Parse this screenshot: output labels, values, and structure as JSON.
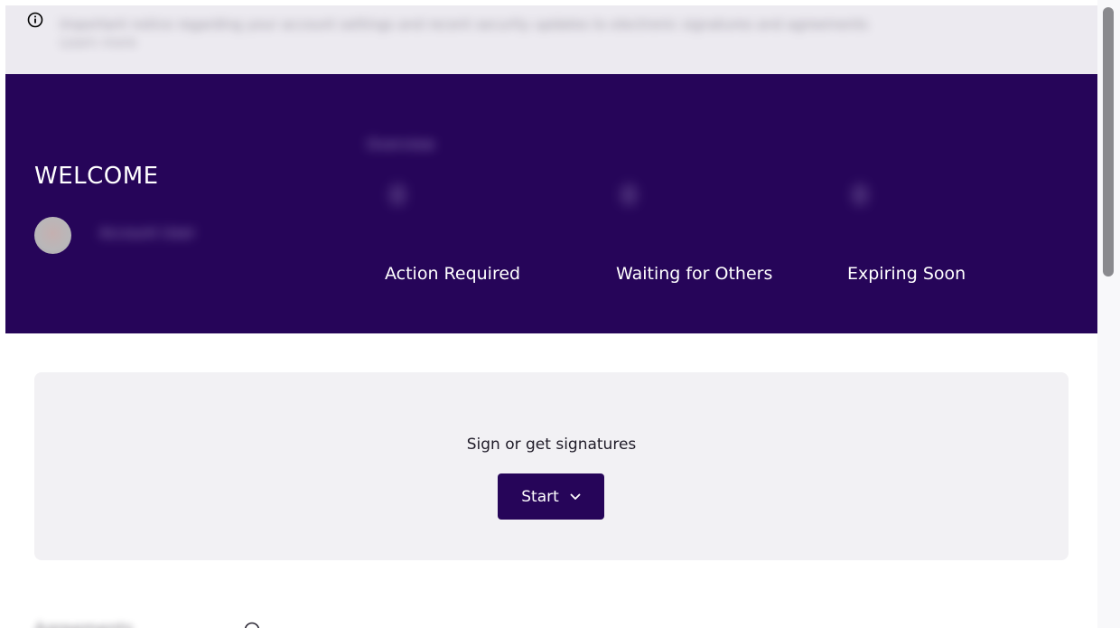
{
  "banner": {
    "icon": "info-icon",
    "text": "Important notice regarding your account settings and recent security updates to electronic signatures and agreements",
    "text_line2": "Learn more"
  },
  "hero": {
    "welcome_title": "WELCOME",
    "user_name": "Account User",
    "overview_label": "Overview",
    "stats": [
      {
        "count": "0",
        "label": "Action Required"
      },
      {
        "count": "0",
        "label": "Waiting for Others"
      },
      {
        "count": "0",
        "label": "Expiring Soon"
      }
    ]
  },
  "sign_card": {
    "prompt": "Sign or get signatures",
    "start_label": "Start"
  },
  "bottom": {
    "heading": "Agreements"
  },
  "colors": {
    "brand": "#260559",
    "banner_bg": "#eceaf0",
    "card_bg": "#f2f1f4"
  }
}
